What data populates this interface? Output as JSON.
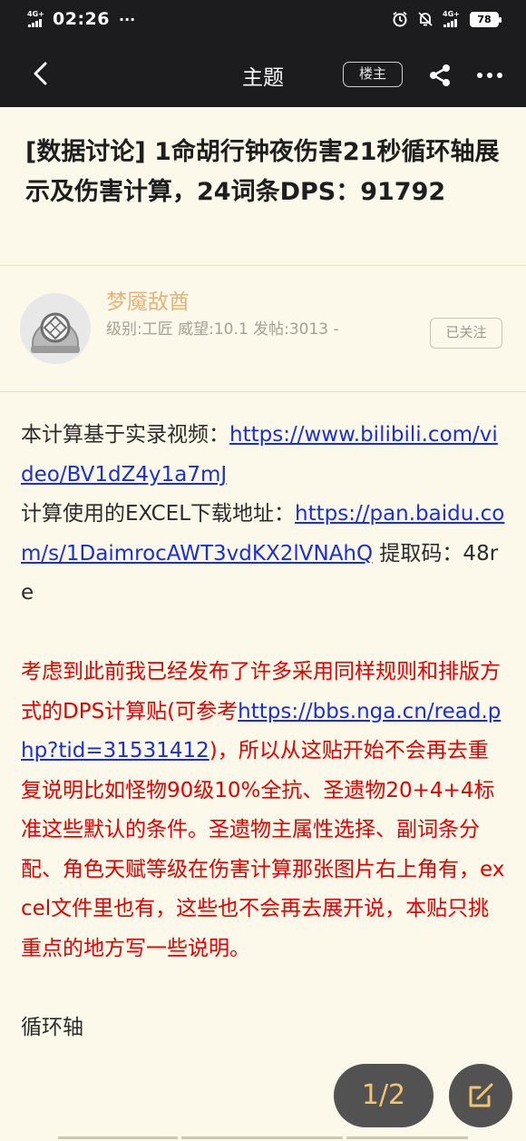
{
  "status_bar": {
    "network_left": "4G+",
    "time": "02:26",
    "dots": "···",
    "network_right": "4G+",
    "battery": "78"
  },
  "nav": {
    "title": "主题",
    "op_badge": "楼主"
  },
  "post": {
    "title": "[数据讨论] 1命胡行钟夜伤害21秒循环轴展示及伤害计算，24词条DPS：91792"
  },
  "author": {
    "name": "梦魇敌酋",
    "meta": "级别:工匠 威望:10.1 发帖:3013 -",
    "follow_label": "已关注"
  },
  "content": {
    "p1_prefix": "本计算基于实录视频：",
    "p1_link": "https://www.bilibili.com/video/BV1dZ4y1a7mJ",
    "p2_prefix": "计算使用的EXCEL下载地址：",
    "p2_link": "https://pan.baidu.com/s/1DaimrocAWT3vdKX2lVNAhQ",
    "p2_suffix": " 提取码：48re",
    "red_prefix": "考虑到此前我已经发布了许多采用同样规则和排版方式的DPS计算贴(可参考",
    "red_link": "https://bbs.nga.cn/read.php?tid=31531412",
    "red_suffix": ")，所以从这贴开始不会再去重复说明比如怪物90级10%全抗、圣遗物20+4+4标准这些默认的条件。圣遗物主属性选择、副词条分配、角色天赋等级在伤害计算那张图片右上角有，excel文件里也有，这些也不会再去展开说，本贴只挑重点的地方写一些说明。",
    "section": "循环轴"
  },
  "pager": {
    "label": "1/2"
  },
  "colors": {
    "background": "#fdf9ea",
    "header": "#1c1c1e",
    "author_name": "#e2b47c",
    "link": "#1b2fd6",
    "notice": "#e00000",
    "pager_text": "#f3c36b"
  }
}
